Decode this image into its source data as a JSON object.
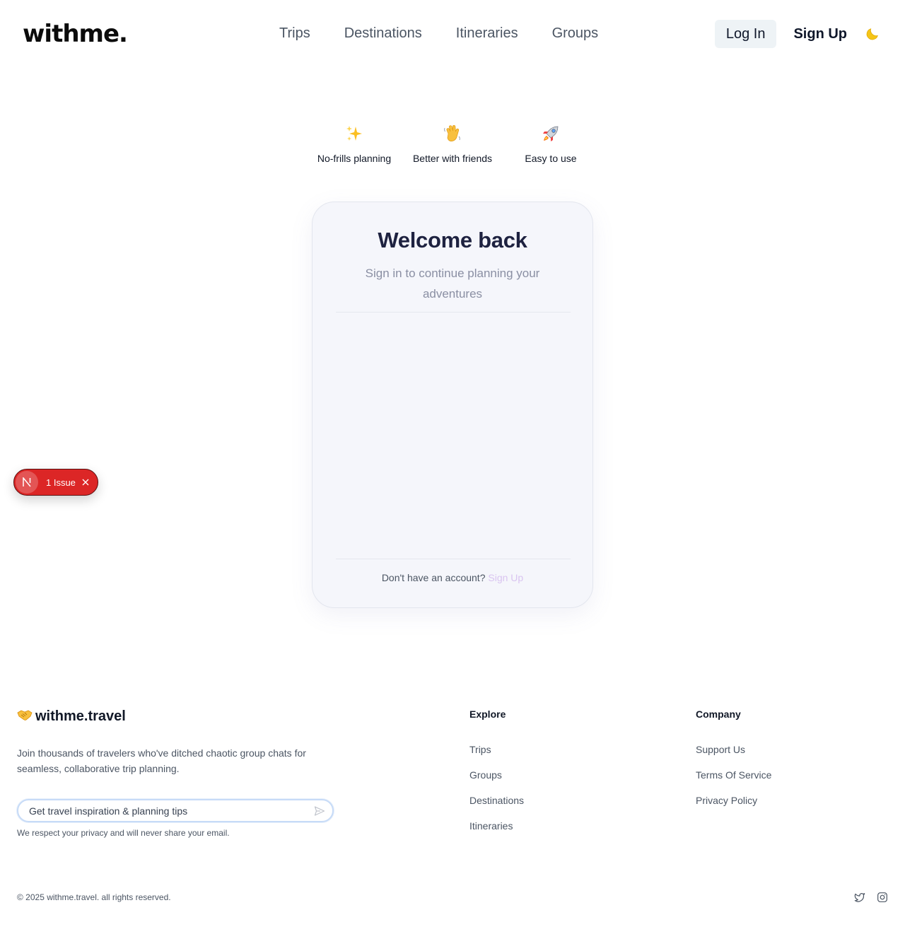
{
  "header": {
    "logo": "withme.",
    "nav": [
      "Trips",
      "Destinations",
      "Itineraries",
      "Groups"
    ],
    "login_label": "Log In",
    "signup_label": "Sign Up",
    "theme_icon": "moon-icon"
  },
  "features": [
    {
      "icon": "sparkles-icon",
      "label": "No-frills planning"
    },
    {
      "icon": "waving-hand-icon",
      "label": "Better with friends"
    },
    {
      "icon": "rocket-icon",
      "label": "Easy to use"
    }
  ],
  "card": {
    "title": "Welcome back",
    "subtitle": "Sign in to continue planning your adventures",
    "footer_text": "Don't have an account?",
    "footer_link": "Sign Up"
  },
  "issue_badge": {
    "count_label": "1 Issue",
    "color": "#dc2626"
  },
  "footer": {
    "brand": "withme.travel",
    "brand_icon": "handshake-icon",
    "description": "Join thousands of travelers who've ditched chaotic group chats for seamless, collaborative trip planning.",
    "newsletter_placeholder": "Get travel inspiration & planning tips",
    "privacy_note": "We respect your privacy and will never share your email.",
    "explore": {
      "heading": "Explore",
      "links": [
        "Trips",
        "Groups",
        "Destinations",
        "Itineraries"
      ]
    },
    "company": {
      "heading": "Company",
      "links": [
        "Support Us",
        "Terms Of Service",
        "Privacy Policy"
      ]
    },
    "copyright": "© 2025 withme.travel. all rights reserved.",
    "social_icons": [
      "twitter-icon",
      "instagram-icon"
    ]
  },
  "colors": {
    "card_background": "#f5f6fb",
    "title": "#1e2240",
    "link_muted": "#d9c4f0"
  }
}
